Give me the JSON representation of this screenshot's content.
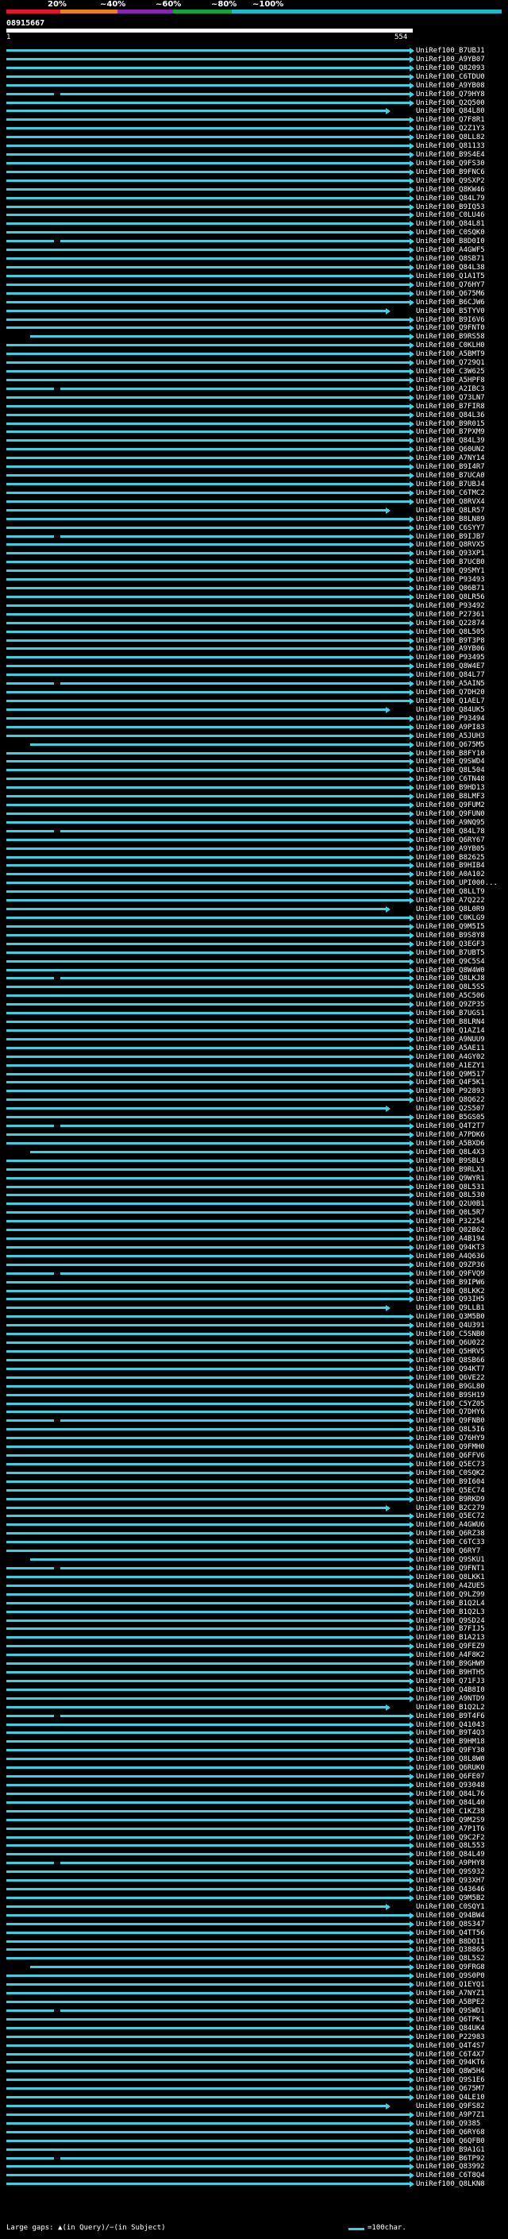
{
  "scale": {
    "labels": [
      "20%",
      "~40%",
      "~60%",
      "~80%",
      "~100%"
    ],
    "colors": [
      "#e3172b",
      "#ee7d1c",
      "#8b25b3",
      "#16a23a",
      "#1abbcc"
    ]
  },
  "query": {
    "id": "08915667",
    "start": "1",
    "end": "554",
    "bar_color": "#ffffff"
  },
  "hit_color": "#3ecfe0",
  "hits": [
    {
      "label": "UniRef100_B7UBJ1"
    },
    {
      "label": "UniRef100_A9YB07"
    },
    {
      "label": "UniRef100_Q82093"
    },
    {
      "label": "UniRef100_C6TDU0"
    },
    {
      "label": "UniRef100_A9YB08"
    },
    {
      "label": "UniRef100_Q79HY8"
    },
    {
      "label": "UniRef100_Q2Q500"
    },
    {
      "label": "UniRef100_Q84L80"
    },
    {
      "label": "UniRef100_Q7F8R1"
    },
    {
      "label": "UniRef100_Q2Z1Y3"
    },
    {
      "label": "UniRef100_Q8LL82"
    },
    {
      "label": "UniRef100_Q81133"
    },
    {
      "label": "UniRef100_B9S4E4"
    },
    {
      "label": "UniRef100_Q9FS30"
    },
    {
      "label": "UniRef100_B9FNC6"
    },
    {
      "label": "UniRef100_Q9SXP2"
    },
    {
      "label": "UniRef100_Q8KW46"
    },
    {
      "label": "UniRef100_Q84L79"
    },
    {
      "label": "UniRef100_B9IQ53"
    },
    {
      "label": "UniRef100_C0LU46"
    },
    {
      "label": "UniRef100_Q84L81"
    },
    {
      "label": "UniRef100_C0SQK0"
    },
    {
      "label": "UniRef100_B8D0I0"
    },
    {
      "label": "UniRef100_A4GWF5"
    },
    {
      "label": "UniRef100_Q8SB71"
    },
    {
      "label": "UniRef100_Q84L38"
    },
    {
      "label": "UniRef100_Q1A1T5"
    },
    {
      "label": "UniRef100_Q76HY7"
    },
    {
      "label": "UniRef100_Q675M6"
    },
    {
      "label": "UniRef100_B6CJW6"
    },
    {
      "label": "UniRef100_B5TYV0"
    },
    {
      "label": "UniRef100_B9I6V6"
    },
    {
      "label": "UniRef100_Q9FNT0"
    },
    {
      "label": "UniRef100_B9RS58"
    },
    {
      "label": "UniRef100_C0KLH0"
    },
    {
      "label": "UniRef100_A5BMT9"
    },
    {
      "label": "UniRef100_Q729Q1"
    },
    {
      "label": "UniRef100_C3W625"
    },
    {
      "label": "UniRef100_A5HPF8"
    },
    {
      "label": "UniRef100_A2IBC3"
    },
    {
      "label": "UniRef100_Q73LN7"
    },
    {
      "label": "UniRef100_B7FIR8"
    },
    {
      "label": "UniRef100_Q84L36"
    },
    {
      "label": "UniRef100_B9R015"
    },
    {
      "label": "UniRef100_B7PXM9"
    },
    {
      "label": "UniRef100_Q84L39"
    },
    {
      "label": "UniRef100_Q60UN2"
    },
    {
      "label": "UniRef100_A7NY14"
    },
    {
      "label": "UniRef100_B9I4R7"
    },
    {
      "label": "UniRef100_B7UCA0"
    },
    {
      "label": "UniRef100_B7UBJ4"
    },
    {
      "label": "UniRef100_C6TMC2"
    },
    {
      "label": "UniRef100_Q8RVX4"
    },
    {
      "label": "UniRef100_Q8LR57"
    },
    {
      "label": "UniRef100_B8LN89"
    },
    {
      "label": "UniRef100_C6SYY7"
    },
    {
      "label": "UniRef100_B9IJB7"
    },
    {
      "label": "UniRef100_Q8RVX5"
    },
    {
      "label": "UniRef100_Q93XP1"
    },
    {
      "label": "UniRef100_B7UCB0"
    },
    {
      "label": "UniRef100_Q9SMY1"
    },
    {
      "label": "UniRef100_P93493"
    },
    {
      "label": "UniRef100_Q06B71"
    },
    {
      "label": "UniRef100_Q8LR56"
    },
    {
      "label": "UniRef100_P93492"
    },
    {
      "label": "UniRef100_P27361"
    },
    {
      "label": "UniRef100_Q22874"
    },
    {
      "label": "UniRef100_Q8L505"
    },
    {
      "label": "UniRef100_B9T3P8"
    },
    {
      "label": "UniRef100_A9YB06"
    },
    {
      "label": "UniRef100_P93495"
    },
    {
      "label": "UniRef100_Q8W4E7"
    },
    {
      "label": "UniRef100_Q84L77"
    },
    {
      "label": "UniRef100_A5AIN5"
    },
    {
      "label": "UniRef100_Q7DH20"
    },
    {
      "label": "UniRef100_Q1AEL7"
    },
    {
      "label": "UniRef100_Q84UK5"
    },
    {
      "label": "UniRef100_P93494"
    },
    {
      "label": "UniRef100_A9PI83"
    },
    {
      "label": "UniRef100_A5JUH3"
    },
    {
      "label": "UniRef100_Q675M5"
    },
    {
      "label": "UniRef100_B8FY10"
    },
    {
      "label": "UniRef100_Q9SWD4"
    },
    {
      "label": "UniRef100_Q8L504"
    },
    {
      "label": "UniRef100_C6TN48"
    },
    {
      "label": "UniRef100_B9HD13"
    },
    {
      "label": "UniRef100_B8LMF3"
    },
    {
      "label": "UniRef100_Q9FUM2"
    },
    {
      "label": "UniRef100_Q9FUN0"
    },
    {
      "label": "UniRef100_A9NQ95"
    },
    {
      "label": "UniRef100_Q84L78"
    },
    {
      "label": "UniRef100_Q6RY67"
    },
    {
      "label": "UniRef100_A9YB05"
    },
    {
      "label": "UniRef100_B82625"
    },
    {
      "label": "UniRef100_B9HIB4"
    },
    {
      "label": "UniRef100_A0A102"
    },
    {
      "label": "UniRef100_UPI000..."
    },
    {
      "label": "UniRef100_Q8LLT9"
    },
    {
      "label": "UniRef100_A7Q222"
    },
    {
      "label": "UniRef100_Q8L0R9"
    },
    {
      "label": "UniRef100_C0KLG9"
    },
    {
      "label": "UniRef100_Q9M5I5"
    },
    {
      "label": "UniRef100_B9S8Y8"
    },
    {
      "label": "UniRef100_Q3EGF3"
    },
    {
      "label": "UniRef100_B7UBT5"
    },
    {
      "label": "UniRef100_Q9C5S4"
    },
    {
      "label": "UniRef100_Q8W4W0"
    },
    {
      "label": "UniRef100_Q8LKJ8"
    },
    {
      "label": "UniRef100_Q8L5S5"
    },
    {
      "label": "UniRef100_A5C506"
    },
    {
      "label": "UniRef100_Q9ZP35"
    },
    {
      "label": "UniRef100_B7UGS1"
    },
    {
      "label": "UniRef100_B8LRN4"
    },
    {
      "label": "UniRef100_Q1AZ14"
    },
    {
      "label": "UniRef100_A9NUU9"
    },
    {
      "label": "UniRef100_A5AE11"
    },
    {
      "label": "UniRef100_A4GY02"
    },
    {
      "label": "UniRef100_A1EZY1"
    },
    {
      "label": "UniRef100_Q9M517"
    },
    {
      "label": "UniRef100_Q4F5K1"
    },
    {
      "label": "UniRef100_P92893"
    },
    {
      "label": "UniRef100_Q8Q622"
    },
    {
      "label": "UniRef100_Q2S507"
    },
    {
      "label": "UniRef100_B5GS05"
    },
    {
      "label": "UniRef100_Q4T2T7"
    },
    {
      "label": "UniRef100_A7PDK6"
    },
    {
      "label": "UniRef100_A5BXD6"
    },
    {
      "label": "UniRef100_Q8L4X3"
    },
    {
      "label": "UniRef100_B9SBL9"
    },
    {
      "label": "UniRef100_B9RLX1"
    },
    {
      "label": "UniRef100_Q9WYR1"
    },
    {
      "label": "UniRef100_Q8L531"
    },
    {
      "label": "UniRef100_Q8L530"
    },
    {
      "label": "UniRef100_Q2U0B1"
    },
    {
      "label": "UniRef100_Q0L5R7"
    },
    {
      "label": "UniRef100_P32254"
    },
    {
      "label": "UniRef100_Q02B62"
    },
    {
      "label": "UniRef100_A4B194"
    },
    {
      "label": "UniRef100_Q94KT3"
    },
    {
      "label": "UniRef100_A4Q636"
    },
    {
      "label": "UniRef100_Q9ZP36"
    },
    {
      "label": "UniRef100_Q9FVQ9"
    },
    {
      "label": "UniRef100_B9IPW6"
    },
    {
      "label": "UniRef100_Q8LKK2"
    },
    {
      "label": "UniRef100_Q93IH5"
    },
    {
      "label": "UniRef100_Q9LLB1"
    },
    {
      "label": "UniRef100_Q3M5B0"
    },
    {
      "label": "UniRef100_Q4U391"
    },
    {
      "label": "UniRef100_C5SNB0"
    },
    {
      "label": "UniRef100_Q6U022"
    },
    {
      "label": "UniRef100_Q5HRV5"
    },
    {
      "label": "UniRef100_Q8SB66"
    },
    {
      "label": "UniRef100_Q94KT7"
    },
    {
      "label": "UniRef100_Q6VE22"
    },
    {
      "label": "UniRef100_B9GL80"
    },
    {
      "label": "UniRef100_B9SH19"
    },
    {
      "label": "UniRef100_C5YZ05"
    },
    {
      "label": "UniRef100_Q7DHY6"
    },
    {
      "label": "UniRef100_Q9FNB0"
    },
    {
      "label": "UniRef100_Q8L5I6"
    },
    {
      "label": "UniRef100_Q76HY9"
    },
    {
      "label": "UniRef100_Q9FMH0"
    },
    {
      "label": "UniRef100_Q6FFV6"
    },
    {
      "label": "UniRef100_Q5EC73"
    },
    {
      "label": "UniRef100_C0SQK2"
    },
    {
      "label": "UniRef100_B9I604"
    },
    {
      "label": "UniRef100_Q5EC74"
    },
    {
      "label": "UniRef100_B9RKD9"
    },
    {
      "label": "UniRef100_B2C279"
    },
    {
      "label": "UniRef100_Q5EC72"
    },
    {
      "label": "UniRef100_A4GWU6"
    },
    {
      "label": "UniRef100_Q6RZ38"
    },
    {
      "label": "UniRef100_C6TC33"
    },
    {
      "label": "UniRef100_Q6RY7"
    },
    {
      "label": "UniRef100_Q9SKU1"
    },
    {
      "label": "UniRef100_Q9FNT1"
    },
    {
      "label": "UniRef100_Q8LKK1"
    },
    {
      "label": "UniRef100_A4ZUE5"
    },
    {
      "label": "UniRef100_Q9LZ99"
    },
    {
      "label": "UniRef100_B1Q2L4"
    },
    {
      "label": "UniRef100_B1Q2L3"
    },
    {
      "label": "UniRef100_Q9SD24"
    },
    {
      "label": "UniRef100_B7FIJ5"
    },
    {
      "label": "UniRef100_B1A213"
    },
    {
      "label": "UniRef100_Q9FEZ9"
    },
    {
      "label": "UniRef100_A4F8K2"
    },
    {
      "label": "UniRef100_B9GHW9"
    },
    {
      "label": "UniRef100_B9HTH5"
    },
    {
      "label": "UniRef100_Q71FJ3"
    },
    {
      "label": "UniRef100_Q4B8I0"
    },
    {
      "label": "UniRef100_A9NTD9"
    },
    {
      "label": "UniRef100_B1Q2L2"
    },
    {
      "label": "UniRef100_B9T4F6"
    },
    {
      "label": "UniRef100_Q41043"
    },
    {
      "label": "UniRef100_B9T4Q3"
    },
    {
      "label": "UniRef100_B9HM18"
    },
    {
      "label": "UniRef100_Q9FY30"
    },
    {
      "label": "UniRef100_Q8L8W0"
    },
    {
      "label": "UniRef100_Q6RUK0"
    },
    {
      "label": "UniRef100_Q6FE07"
    },
    {
      "label": "UniRef100_Q93048"
    },
    {
      "label": "UniRef100_Q84L76"
    },
    {
      "label": "UniRef100_Q84L40"
    },
    {
      "label": "UniRef100_C1KZ38"
    },
    {
      "label": "UniRef100_Q9M2S9"
    },
    {
      "label": "UniRef100_A7P1T6"
    },
    {
      "label": "UniRef100_Q9C2F2"
    },
    {
      "label": "UniRef100_Q8L553"
    },
    {
      "label": "UniRef100_Q84L49"
    },
    {
      "label": "UniRef100_A9PHY8"
    },
    {
      "label": "UniRef100_Q9S932"
    },
    {
      "label": "UniRef100_Q93XH7"
    },
    {
      "label": "UniRef100_Q43646"
    },
    {
      "label": "UniRef100_Q9M5B2"
    },
    {
      "label": "UniRef100_C0SQY1"
    },
    {
      "label": "UniRef100_Q94BW4"
    },
    {
      "label": "UniRef100_Q8S347"
    },
    {
      "label": "UniRef100_Q4TT56"
    },
    {
      "label": "UniRef100_B8DOI1"
    },
    {
      "label": "UniRef100_Q38865"
    },
    {
      "label": "UniRef100_Q8L5S2"
    },
    {
      "label": "UniRef100_Q9FRG8"
    },
    {
      "label": "UniRef100_Q9S0P0"
    },
    {
      "label": "UniRef100_Q1EYQ1"
    },
    {
      "label": "UniRef100_A7NYZ1"
    },
    {
      "label": "UniRef100_A5BPE2"
    },
    {
      "label": "UniRef100_Q9SWD1"
    },
    {
      "label": "UniRef100_Q6TPK1"
    },
    {
      "label": "UniRef100_Q84UK4"
    },
    {
      "label": "UniRef100_P22983"
    },
    {
      "label": "UniRef100_Q4T4S7"
    },
    {
      "label": "UniRef100_C6T4X7"
    },
    {
      "label": "UniRef100_Q94KT6"
    },
    {
      "label": "UniRef100_Q8W5H4"
    },
    {
      "label": "UniRef100_Q9S1E6"
    },
    {
      "label": "UniRef100_Q675M7"
    },
    {
      "label": "UniRef100_Q4LE10"
    },
    {
      "label": "UniRef100_Q9FS82"
    },
    {
      "label": "UniRef100_A9P7Z1"
    },
    {
      "label": "UniRef100_Q9385"
    },
    {
      "label": "UniRef100_Q6RY68"
    },
    {
      "label": "UniRef100_Q6QFB0"
    },
    {
      "label": "UniRef100_B9A1G1"
    },
    {
      "label": "UniRef100_B6TP92"
    },
    {
      "label": "UniRef100_Q83992"
    },
    {
      "label": "UniRef100_C6T8Q4"
    },
    {
      "label": "UniRef100_Q8LKN8"
    }
  ],
  "legend": {
    "gaps_text": "Large gaps: ▲(in Query)/−(in Subject)",
    "scale_text": "=100char."
  }
}
